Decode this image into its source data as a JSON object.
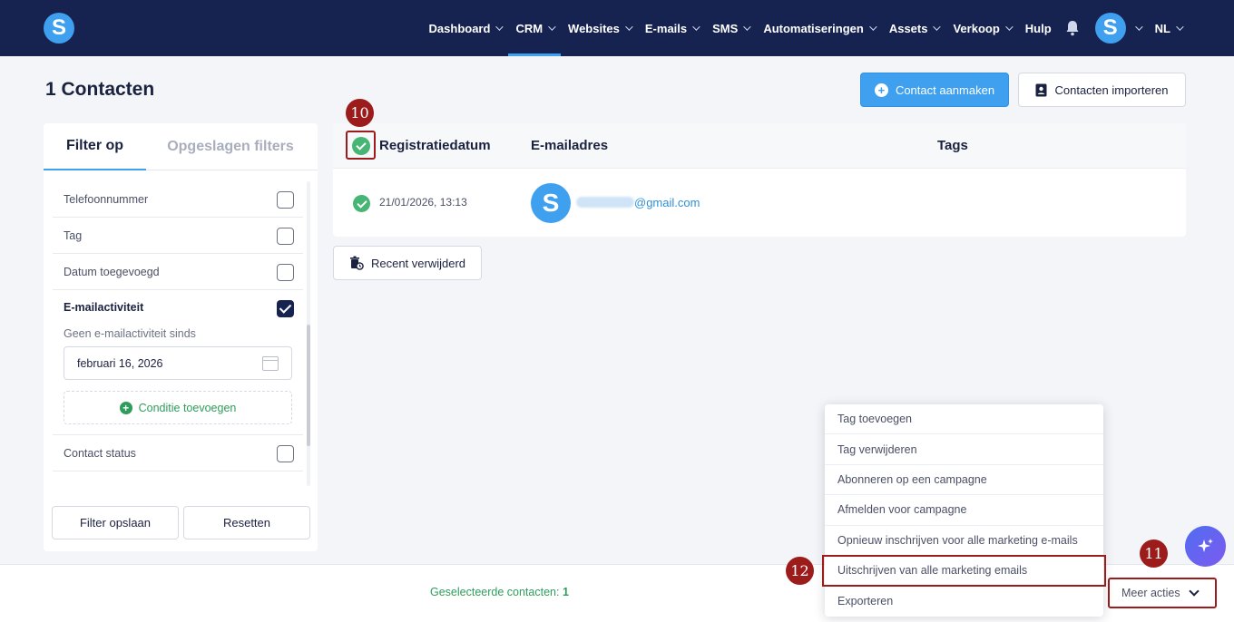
{
  "nav": {
    "logo_letter": "S",
    "items": [
      {
        "label": "Dashboard",
        "has_chevron": true
      },
      {
        "label": "CRM",
        "has_chevron": true,
        "active": true
      },
      {
        "label": "Websites",
        "has_chevron": true
      },
      {
        "label": "E-mails",
        "has_chevron": true
      },
      {
        "label": "SMS",
        "has_chevron": true
      },
      {
        "label": "Automatiseringen",
        "has_chevron": true
      },
      {
        "label": "Assets",
        "has_chevron": true
      },
      {
        "label": "Verkoop",
        "has_chevron": true
      },
      {
        "label": "Hulp",
        "has_chevron": false
      }
    ],
    "avatar_letter": "S",
    "language": "NL"
  },
  "page": {
    "title": "1 Contacten",
    "create_button": "Contact aanmaken",
    "import_button": "Contacten importeren"
  },
  "filters": {
    "tab_active": "Filter op",
    "tab_inactive": "Opgeslagen filters",
    "rows_top": [
      {
        "label": "Telefoonnummer",
        "checked": false
      },
      {
        "label": "Tag",
        "checked": false
      },
      {
        "label": "Datum toegevoegd",
        "checked": false
      }
    ],
    "email_activity": {
      "label": "E-mailactiviteit",
      "checked": true,
      "sub_label": "Geen e-mailactiviteit sinds",
      "date_value": "februari 16, 2026",
      "add_condition": "Conditie toevoegen"
    },
    "rows_bottom": [
      {
        "label": "Contact status",
        "checked": false
      }
    ],
    "save_button": "Filter opslaan",
    "reset_button": "Resetten"
  },
  "table": {
    "columns": [
      "Registratiedatum",
      "E-mailadres",
      "Tags"
    ],
    "rows": [
      {
        "date": "21/01/2026, 13:13",
        "avatar_letter": "S",
        "email_domain": "@gmail.com",
        "tags": ""
      }
    ]
  },
  "recent_deleted_button": "Recent verwijderd",
  "bottom": {
    "selected_label": "Geselecteerde contacten:",
    "selected_count": "1",
    "more_actions": "Meer acties"
  },
  "dropdown": {
    "items": [
      "Tag toevoegen",
      "Tag verwijderen",
      "Abonneren op een campagne",
      "Afmelden voor campagne",
      "Opnieuw inschrijven voor alle marketing e-mails",
      "Uitschrijven van alle marketing emails",
      "Exporteren"
    ],
    "highlighted_index": 5
  },
  "markers": {
    "m10": "10",
    "m11": "11",
    "m12": "12"
  },
  "colors": {
    "nav_bg": "#162351",
    "accent": "#3fa0f0",
    "success": "#47b574",
    "marker": "#9c1c1c"
  },
  "icons": [
    "bell-icon",
    "plus-circle-icon",
    "contact-card-icon",
    "calendar-icon",
    "trash-clock-icon",
    "sparkle-icon",
    "chevron-down-icon",
    "check-circle-icon"
  ]
}
